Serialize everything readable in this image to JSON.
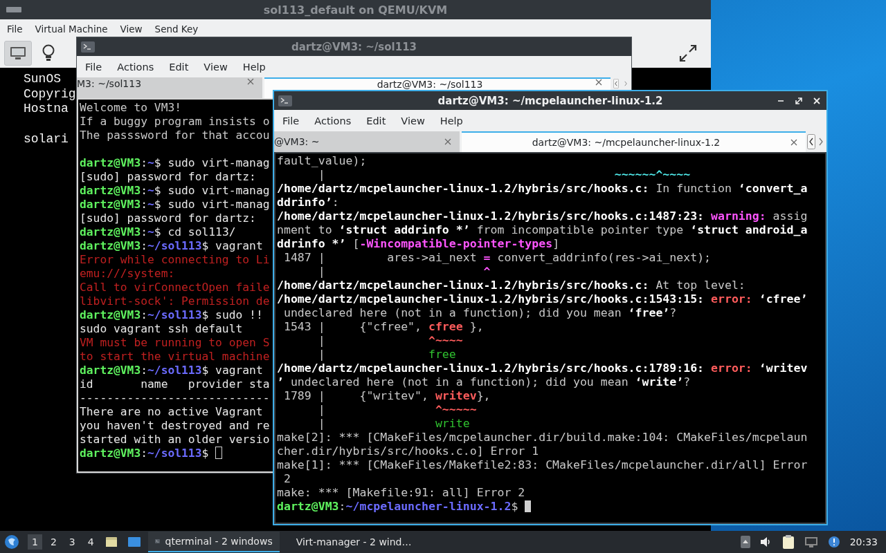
{
  "vm_window": {
    "title": "sol113_default on QEMU/KVM",
    "menu": [
      "File",
      "Virtual Machine",
      "View",
      "Send Key"
    ],
    "toolbar": [
      {
        "kind": "console",
        "selected": true
      },
      {
        "kind": "details",
        "selected": false
      }
    ],
    "console_blocks": [
      [
        "SunOS",
        "Copyrig",
        "Hostna"
      ],
      [
        "solari"
      ]
    ]
  },
  "terminals": [
    {
      "title": "dartz@VM3: ~/sol113",
      "focused": false,
      "menu": [
        "File",
        "Actions",
        "Edit",
        "View",
        "Help"
      ],
      "tabs": [
        {
          "label": "M3: ~/sol113",
          "selected": false
        },
        {
          "label": "dartz@VM3: ~/sol113",
          "selected": true
        }
      ],
      "blocks": [
        [
          {
            "segs": [
              {
                "kind": "plain",
                "text": "Welcome to VM3!"
              }
            ]
          },
          {
            "segs": [
              {
                "kind": "plain",
                "text": "If a buggy program insists o"
              }
            ]
          },
          {
            "segs": [
              {
                "kind": "plain",
                "text": "The passsword for that accou"
              }
            ]
          }
        ],
        [
          {
            "segs": [
              {
                "kind": "user",
                "text": "dartz@VM3"
              },
              {
                "kind": "light",
                "text": ":"
              },
              {
                "kind": "path",
                "text": "~"
              },
              {
                "kind": "light",
                "text": "$ sudo virt-manag"
              }
            ]
          },
          {
            "segs": [
              {
                "kind": "light",
                "text": "[sudo] password for dartz:"
              }
            ]
          },
          {
            "segs": [
              {
                "kind": "user",
                "text": "dartz@VM3"
              },
              {
                "kind": "light",
                "text": ":"
              },
              {
                "kind": "path",
                "text": "~"
              },
              {
                "kind": "light",
                "text": "$ sudo virt-manag"
              }
            ]
          },
          {
            "segs": [
              {
                "kind": "user",
                "text": "dartz@VM3"
              },
              {
                "kind": "light",
                "text": ":"
              },
              {
                "kind": "path",
                "text": "~"
              },
              {
                "kind": "light",
                "text": "$ sudo virt-manag"
              }
            ]
          },
          {
            "segs": [
              {
                "kind": "light",
                "text": "[sudo] password for dartz:"
              }
            ]
          },
          {
            "segs": [
              {
                "kind": "user",
                "text": "dartz@VM3"
              },
              {
                "kind": "light",
                "text": ":"
              },
              {
                "kind": "path",
                "text": "~"
              },
              {
                "kind": "light",
                "text": "$ cd sol113/"
              }
            ]
          },
          {
            "segs": [
              {
                "kind": "user",
                "text": "dartz@VM3"
              },
              {
                "kind": "light",
                "text": ":"
              },
              {
                "kind": "path",
                "text": "~/sol113"
              },
              {
                "kind": "light",
                "text": "$ vagrant"
              }
            ]
          },
          {
            "segs": [
              {
                "kind": "failure",
                "text": "Error while connecting to Li"
              }
            ]
          },
          {
            "segs": [
              {
                "kind": "failure",
                "text": "emu:///system:"
              }
            ]
          },
          {
            "segs": [
              {
                "kind": "failure",
                "text": "Call to virConnectOpen faile"
              }
            ]
          },
          {
            "segs": [
              {
                "kind": "failure",
                "text": "libvirt-sock': Permission de"
              }
            ]
          },
          {
            "segs": [
              {
                "kind": "user",
                "text": "dartz@VM3"
              },
              {
                "kind": "light",
                "text": ":"
              },
              {
                "kind": "path",
                "text": "~/sol113"
              },
              {
                "kind": "light",
                "text": "$ sudo !!"
              }
            ]
          },
          {
            "segs": [
              {
                "kind": "light",
                "text": "sudo vagrant ssh default"
              }
            ]
          },
          {
            "segs": [
              {
                "kind": "failure",
                "text": "VM must be running to open S"
              }
            ]
          },
          {
            "segs": [
              {
                "kind": "failure",
                "text": "to start the virtual machine"
              }
            ]
          },
          {
            "segs": [
              {
                "kind": "user",
                "text": "dartz@VM3"
              },
              {
                "kind": "light",
                "text": ":"
              },
              {
                "kind": "path",
                "text": "~/sol113"
              },
              {
                "kind": "light",
                "text": "$ vagrant"
              }
            ]
          },
          {
            "segs": [
              {
                "kind": "light",
                "text": "id       name   provider sta"
              }
            ]
          },
          {
            "segs": [
              {
                "kind": "light",
                "text": "----------------------------"
              }
            ]
          },
          {
            "segs": [
              {
                "kind": "light",
                "text": "There are no active Vagrant"
              }
            ]
          },
          {
            "segs": [
              {
                "kind": "light",
                "text": "you haven't destroyed and re"
              }
            ]
          },
          {
            "segs": [
              {
                "kind": "light",
                "text": "started with an older versio"
              }
            ]
          },
          {
            "segs": [
              {
                "kind": "user",
                "text": "dartz@VM3"
              },
              {
                "kind": "light",
                "text": ":"
              },
              {
                "kind": "path",
                "text": "~/sol113"
              },
              {
                "kind": "light",
                "text": "$"
              }
            ]
          }
        ]
      ]
    },
    {
      "title": "dartz@VM3: ~/mcpelauncher-linux-1.2",
      "focused": true,
      "menu": [
        "File",
        "Actions",
        "Edit",
        "View",
        "Help"
      ],
      "tabs": [
        {
          "label": "@VM3: ~",
          "selected": false
        },
        {
          "label": "dartz@VM3: ~/mcpelauncher-linux-1.2",
          "selected": true
        }
      ],
      "blocks": [
        [
          {
            "segs": [
              {
                "kind": "plain",
                "text": "fault_value);"
              }
            ]
          },
          {
            "segs": [
              {
                "kind": "plain",
                "text": "      |                                          "
              },
              {
                "kind": "marker",
                "text": "~~~~~~^~~~~"
              }
            ]
          },
          {
            "segs": [
              {
                "kind": "bold",
                "text": "/home/dartz/mcpelauncher-linux-1.2/hybris/src/hooks.c:"
              },
              {
                "kind": "plain",
                "text": " In function "
              },
              {
                "kind": "bold",
                "text": "‘convert_a"
              }
            ]
          },
          {
            "segs": [
              {
                "kind": "bold",
                "text": "ddrinfo’"
              },
              {
                "kind": "plain",
                "text": ":"
              }
            ]
          },
          {
            "segs": [
              {
                "kind": "bold",
                "text": "/home/dartz/mcpelauncher-linux-1.2/hybris/src/hooks.c:1487:23: "
              },
              {
                "kind": "warning",
                "text": "warning:"
              },
              {
                "kind": "plain",
                "text": " assig"
              }
            ]
          },
          {
            "segs": [
              {
                "kind": "plain",
                "text": "nment to "
              },
              {
                "kind": "bold",
                "text": "‘struct addrinfo *’"
              },
              {
                "kind": "plain",
                "text": " from incompatible pointer type "
              },
              {
                "kind": "bold",
                "text": "‘struct android_a"
              }
            ]
          },
          {
            "segs": [
              {
                "kind": "bold",
                "text": "ddrinfo *’"
              },
              {
                "kind": "plain",
                "text": " ["
              },
              {
                "kind": "warning",
                "text": "-Wincompatible-pointer-types"
              },
              {
                "kind": "plain",
                "text": "]"
              }
            ]
          },
          {
            "segs": [
              {
                "kind": "plain",
                "text": " 1487 |         ares->ai_next "
              },
              {
                "kind": "warning",
                "text": "="
              },
              {
                "kind": "plain",
                "text": " convert_addrinfo(res->ai_next);"
              }
            ]
          },
          {
            "segs": [
              {
                "kind": "plain",
                "text": "      |                       "
              },
              {
                "kind": "warning",
                "text": "^"
              }
            ]
          },
          {
            "segs": [
              {
                "kind": "bold",
                "text": "/home/dartz/mcpelauncher-linux-1.2/hybris/src/hooks.c:"
              },
              {
                "kind": "plain",
                "text": " At top level:"
              }
            ]
          },
          {
            "segs": [
              {
                "kind": "bold",
                "text": "/home/dartz/mcpelauncher-linux-1.2/hybris/src/hooks.c:1543:15: "
              },
              {
                "kind": "error",
                "text": "error:"
              },
              {
                "kind": "bold",
                "text": " ‘cfree’"
              }
            ]
          },
          {
            "segs": [
              {
                "kind": "plain",
                "text": " undeclared here (not in a function); did you mean "
              },
              {
                "kind": "bold",
                "text": "‘free’"
              },
              {
                "kind": "plain",
                "text": "?"
              }
            ]
          },
          {
            "segs": [
              {
                "kind": "plain",
                "text": " 1543 |     {\"cfree\", "
              },
              {
                "kind": "error",
                "text": "cfree"
              },
              {
                "kind": "plain",
                "text": " },"
              }
            ]
          },
          {
            "segs": [
              {
                "kind": "plain",
                "text": "      |               "
              },
              {
                "kind": "error",
                "text": "^~~~~"
              }
            ]
          },
          {
            "segs": [
              {
                "kind": "plain",
                "text": "      |               "
              },
              {
                "kind": "hint",
                "text": "free"
              }
            ]
          },
          {
            "segs": [
              {
                "kind": "bold",
                "text": "/home/dartz/mcpelauncher-linux-1.2/hybris/src/hooks.c:1789:16: "
              },
              {
                "kind": "error",
                "text": "error:"
              },
              {
                "kind": "bold",
                "text": " ‘writev"
              }
            ]
          },
          {
            "segs": [
              {
                "kind": "bold",
                "text": "’"
              },
              {
                "kind": "plain",
                "text": " undeclared here (not in a function); did you mean "
              },
              {
                "kind": "bold",
                "text": "‘write’"
              },
              {
                "kind": "plain",
                "text": "?"
              }
            ]
          },
          {
            "segs": [
              {
                "kind": "plain",
                "text": " 1789 |     {\"writev\", "
              },
              {
                "kind": "error",
                "text": "writev"
              },
              {
                "kind": "plain",
                "text": "},"
              }
            ]
          },
          {
            "segs": [
              {
                "kind": "plain",
                "text": "      |                "
              },
              {
                "kind": "error",
                "text": "^~~~~~"
              }
            ]
          },
          {
            "segs": [
              {
                "kind": "plain",
                "text": "      |                "
              },
              {
                "kind": "hint",
                "text": "write"
              }
            ]
          },
          {
            "segs": [
              {
                "kind": "plain",
                "text": "make[2]: *** [CMakeFiles/mcpelauncher.dir/build.make:104: CMakeFiles/mcpelaun"
              }
            ]
          },
          {
            "segs": [
              {
                "kind": "plain",
                "text": "cher.dir/hybris/src/hooks.c.o] Error 1"
              }
            ]
          },
          {
            "segs": [
              {
                "kind": "plain",
                "text": "make[1]: *** [CMakeFiles/Makefile2:83: CMakeFiles/mcpelauncher.dir/all] Error"
              }
            ]
          },
          {
            "segs": [
              {
                "kind": "plain",
                "text": " 2"
              }
            ]
          },
          {
            "segs": [
              {
                "kind": "plain",
                "text": "make: *** [Makefile:91: all] Error 2"
              }
            ]
          },
          {
            "segs": [
              {
                "kind": "user",
                "text": "dartz@VM3"
              },
              {
                "kind": "plain",
                "text": ":"
              },
              {
                "kind": "path",
                "text": "~/mcpelauncher-linux-1.2"
              },
              {
                "kind": "plain",
                "text": "$"
              }
            ]
          }
        ]
      ]
    }
  ],
  "taskbar": {
    "workspaces": [
      {
        "label": "1",
        "selected": true
      },
      {
        "label": "2",
        "selected": false
      },
      {
        "label": "3",
        "selected": false
      },
      {
        "label": "4",
        "selected": false
      }
    ],
    "tasks": [
      {
        "kind": "terminal",
        "label": "qterminal - 2 windows",
        "selected": true
      },
      {
        "kind": "vm",
        "label": "Virt-manager - 2 wind…",
        "selected": false
      }
    ],
    "clock": "20:33"
  }
}
